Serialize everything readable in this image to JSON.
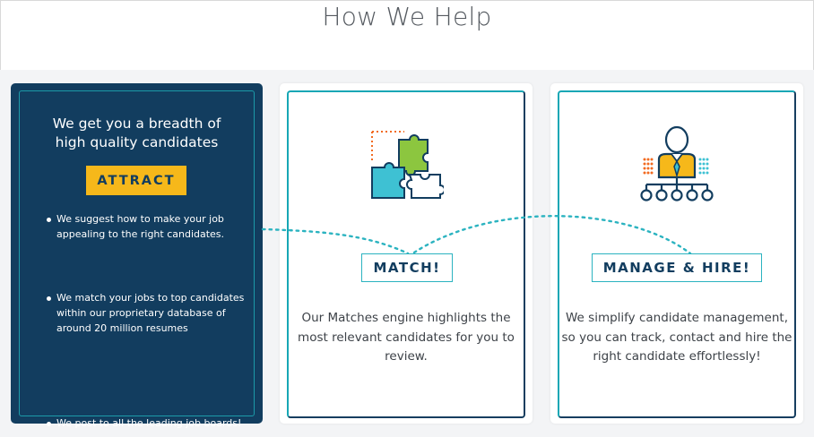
{
  "section": {
    "title": "How We Help"
  },
  "attract": {
    "heading_line1": "We get you a breadth of",
    "heading_line2": "high quality candidates",
    "badge": "ATTRACT",
    "bullets": [
      "We suggest how to make your job appealing to the right candidates.",
      "We match your jobs to top candidates within our proprietary database of around 20 million resumes",
      "We post to all the leading job boards!"
    ]
  },
  "match": {
    "badge": "MATCH!",
    "icon": "puzzle-pieces-icon",
    "description": "Our Matches engine highlights the most relevant candidates for you to review."
  },
  "hire": {
    "badge": "MANAGE & HIRE!",
    "icon": "org-chart-person-icon",
    "description": "We simplify candidate management, so you can track, contact and hire the right candidate effortlessly!"
  },
  "colors": {
    "navy": "#123d5f",
    "teal": "#17a7b5",
    "yellow": "#f6b81a",
    "lime": "#8cc63f",
    "orange": "#f26b21",
    "cyan": "#3ec1d3"
  }
}
